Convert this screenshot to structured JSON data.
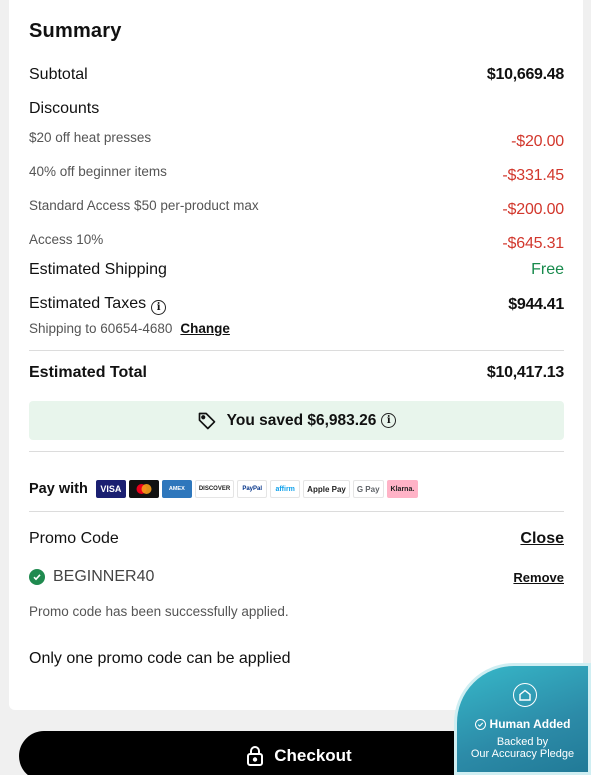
{
  "summary": {
    "title": "Summary",
    "subtotal_label": "Subtotal",
    "subtotal_value": "$10,669.48",
    "discounts_label": "Discounts",
    "discounts": [
      {
        "label": "$20 off heat presses",
        "value": "-$20.00"
      },
      {
        "label": "40% off beginner items",
        "value": "-$331.45"
      },
      {
        "label": "Standard Access $50 per-product max",
        "value": "-$200.00"
      },
      {
        "label": "Access 10%",
        "value": "-$645.31"
      }
    ],
    "shipping_label": "Estimated Shipping",
    "shipping_value": "Free",
    "taxes_label": "Estimated Taxes",
    "taxes_value": "$944.41",
    "shipping_to": "Shipping to 60654-4680",
    "change_label": "Change",
    "total_label": "Estimated Total",
    "total_value": "$10,417.13",
    "saved_text": "You saved $6,983.26"
  },
  "payment": {
    "label": "Pay with",
    "methods": [
      "VISA",
      "MC",
      "AMEX",
      "DISCOVER",
      "PayPal",
      "affirm",
      "Apple Pay",
      "G Pay",
      "Klarna."
    ]
  },
  "promo": {
    "title": "Promo Code",
    "close_label": "Close",
    "applied_code": "BEGINNER40",
    "remove_label": "Remove",
    "success_message": "Promo code has been successfully applied.",
    "note": "Only one promo code can be applied"
  },
  "checkout": {
    "label": "Checkout"
  },
  "badge": {
    "line1": "Human Added",
    "line2": "Backed by",
    "line3": "Our Accuracy Pledge"
  },
  "colors": {
    "discount_red": "#d2372c",
    "free_green": "#178a4c",
    "saved_bg": "#e8f5ec",
    "checkout_bg": "#000000",
    "badge_teal": "#2c8ba8"
  }
}
